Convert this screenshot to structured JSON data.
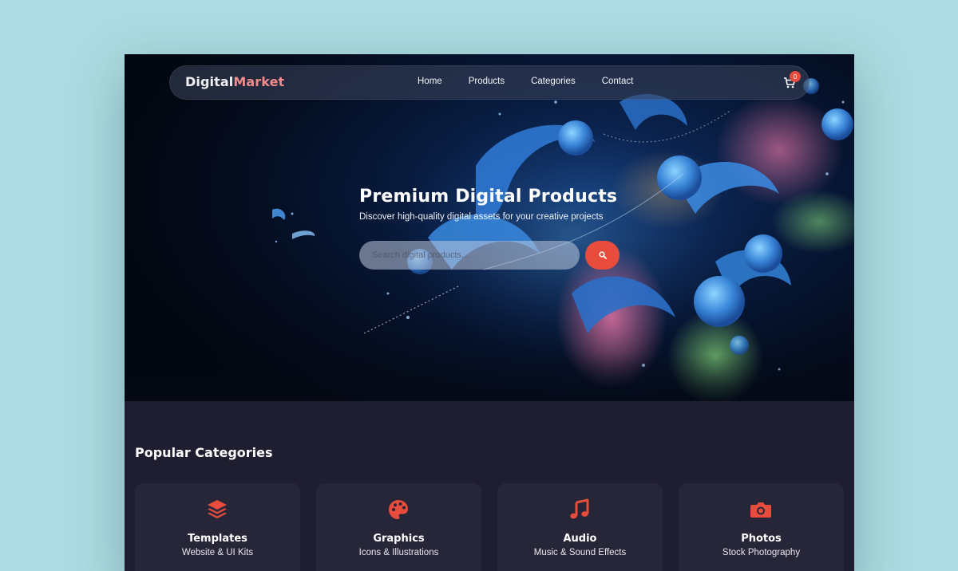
{
  "brand": {
    "part1": "Digital",
    "part2": "Market"
  },
  "nav": {
    "links": [
      "Home",
      "Products",
      "Categories",
      "Contact"
    ]
  },
  "cart": {
    "count": "0"
  },
  "hero": {
    "title": "Premium Digital Products",
    "subtitle": "Discover high-quality digital assets for your creative projects"
  },
  "search": {
    "placeholder": "Search digital products...",
    "value": ""
  },
  "categories": {
    "title": "Popular Categories",
    "items": [
      {
        "title": "Templates",
        "desc": "Website & UI Kits",
        "icon": "layers-icon"
      },
      {
        "title": "Graphics",
        "desc": "Icons & Illustrations",
        "icon": "palette-icon"
      },
      {
        "title": "Audio",
        "desc": "Music & Sound Effects",
        "icon": "music-note-icon"
      },
      {
        "title": "Photos",
        "desc": "Stock Photography",
        "icon": "camera-icon"
      }
    ]
  },
  "colors": {
    "accent": "#e74c3c",
    "page_bg": "#acdbe1",
    "section_bg": "#1f1e30",
    "card_bg": "#272639",
    "brand_accent": "#f38b8b"
  }
}
